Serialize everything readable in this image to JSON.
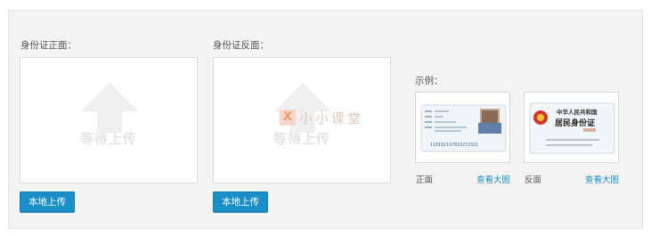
{
  "front": {
    "label": "身份证正面：",
    "placeholder": "等待上传",
    "button": "本地上传"
  },
  "back": {
    "label": "身份证反面：",
    "placeholder": "等待上传",
    "button": "本地上传"
  },
  "watermark": {
    "logo": "X",
    "text": "小小课堂"
  },
  "examples": {
    "label": "示例：",
    "items": [
      {
        "caption": "正面",
        "link": "查看大图",
        "card_number": "110102197810272321"
      },
      {
        "caption": "反面",
        "link": "查看大图",
        "title_line1": "中华人民共和国",
        "title_line2": "居民身份证"
      }
    ]
  },
  "colors": {
    "accent": "#1a8ec7",
    "panel": "#f3f3f3",
    "placeholder": "#e4e4e4"
  },
  "icons": [
    "upload-arrow-icon",
    "national-emblem-icon"
  ]
}
